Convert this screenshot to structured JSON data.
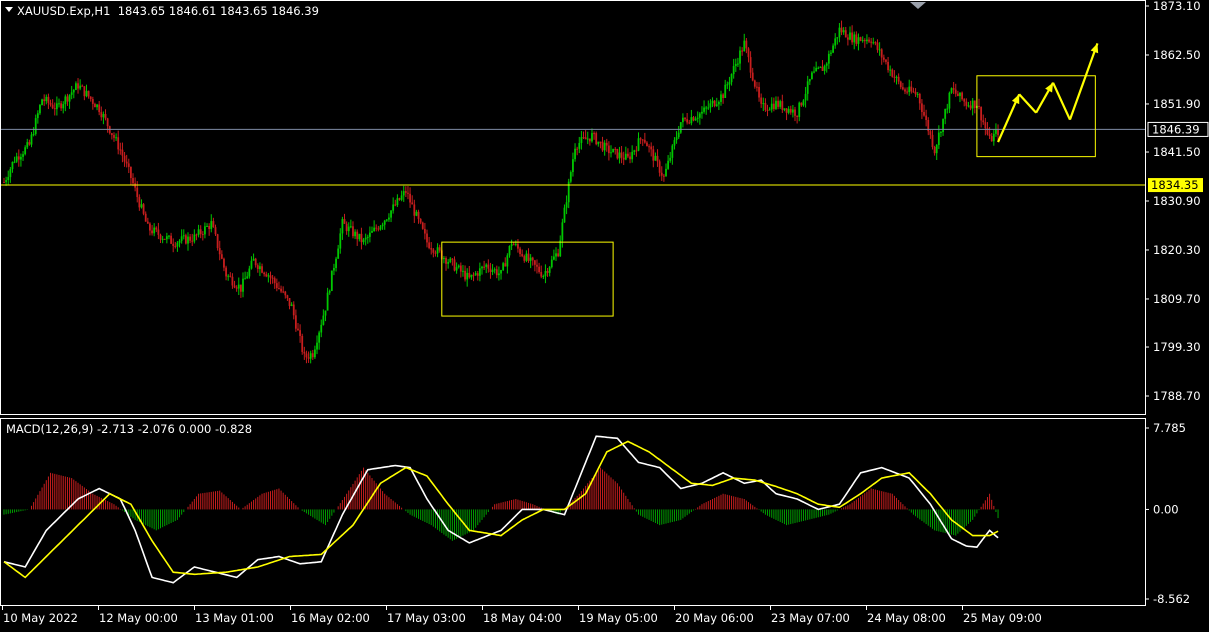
{
  "header": {
    "symbol_line": "XAUUSD.Exp,H1  1843.65 1846.61 1843.65 1846.39",
    "macd_line": "MACD(12,26,9) -2.713 -2.076 0.000 -0.828"
  },
  "colors": {
    "background": "#000000",
    "frame": "#ffffff",
    "text": "#ffffff",
    "bull_candle": "#00c800",
    "bear_candle": "#c81e1e",
    "price_line": "#7f8ca6",
    "level_line": "#ffff00",
    "level_label_bg": "#ffff00",
    "macd_line": "#ffffff",
    "signal_line": "#ffff00",
    "hist_pos": "#c81e1e",
    "hist_neg": "#00a000",
    "annotation": "#ffff00"
  },
  "chart_data": [
    {
      "type": "candlestick",
      "title": "XAUUSD.Exp,H1",
      "ohlc_label": "1843.65 1846.61 1843.65 1846.39",
      "y_ticks": [
        "1873.10",
        "1862.50",
        "1851.90",
        "1841.50",
        "1830.90",
        "1820.30",
        "1809.70",
        "1799.30",
        "1788.70"
      ],
      "ylim": [
        1785.0,
        1874.0
      ],
      "x_ticks": [
        "10 May 2022",
        "12 May 00:00",
        "13 May 01:00",
        "16 May 02:00",
        "17 May 03:00",
        "18 May 04:00",
        "19 May 05:00",
        "20 May 06:00",
        "23 May 07:00",
        "24 May 08:00",
        "25 May 09:00"
      ],
      "current_price": {
        "value": 1846.39,
        "label": "1846.39"
      },
      "horizontal_level": {
        "value": 1834.35,
        "label": "1834.35"
      },
      "close_anchors": [
        [
          0,
          1835
        ],
        [
          5,
          1840
        ],
        [
          12,
          1843
        ],
        [
          18,
          1853
        ],
        [
          25,
          1851
        ],
        [
          35,
          1856
        ],
        [
          45,
          1851
        ],
        [
          55,
          1842
        ],
        [
          60,
          1836
        ],
        [
          68,
          1825
        ],
        [
          80,
          1822
        ],
        [
          90,
          1823
        ],
        [
          98,
          1826
        ],
        [
          105,
          1815
        ],
        [
          112,
          1812
        ],
        [
          118,
          1818
        ],
        [
          125,
          1815
        ],
        [
          130,
          1812
        ],
        [
          136,
          1808
        ],
        [
          142,
          1797
        ],
        [
          146,
          1798
        ],
        [
          152,
          1808
        ],
        [
          160,
          1826
        ],
        [
          170,
          1822
        ],
        [
          180,
          1827
        ],
        [
          190,
          1833
        ],
        [
          200,
          1822
        ],
        [
          210,
          1818
        ],
        [
          220,
          1814
        ],
        [
          228,
          1817
        ],
        [
          235,
          1815
        ],
        [
          240,
          1822
        ],
        [
          248,
          1818
        ],
        [
          255,
          1815
        ],
        [
          262,
          1820
        ],
        [
          270,
          1843
        ],
        [
          278,
          1845
        ],
        [
          285,
          1842
        ],
        [
          295,
          1840
        ],
        [
          302,
          1845
        ],
        [
          312,
          1836
        ],
        [
          320,
          1848
        ],
        [
          330,
          1850
        ],
        [
          340,
          1854
        ],
        [
          350,
          1865
        ],
        [
          358,
          1851
        ],
        [
          365,
          1852
        ],
        [
          375,
          1850
        ],
        [
          382,
          1858
        ],
        [
          388,
          1860
        ],
        [
          395,
          1868
        ],
        [
          402,
          1866
        ],
        [
          410,
          1866
        ],
        [
          418,
          1860
        ],
        [
          425,
          1855
        ],
        [
          432,
          1854
        ],
        [
          440,
          1842
        ],
        [
          448,
          1855
        ],
        [
          455,
          1852
        ],
        [
          460,
          1852
        ],
        [
          466,
          1844
        ],
        [
          470,
          1846
        ]
      ],
      "rectangles": [
        {
          "x_bars": [
            207,
            288
          ],
          "y_values": [
            1822.0,
            1806.0
          ]
        },
        {
          "x_bars": [
            460,
            516
          ],
          "y_values": [
            1858.0,
            1840.5
          ]
        }
      ],
      "projection_path": [
        {
          "bar": 470,
          "value": 1843.65
        },
        {
          "bar": 480,
          "value": 1854.0
        },
        {
          "bar": 488,
          "value": 1850.0
        },
        {
          "bar": 496,
          "value": 1856.5
        },
        {
          "bar": 504,
          "value": 1848.5
        },
        {
          "bar": 517,
          "value": 1865.0
        }
      ]
    },
    {
      "type": "line",
      "title": "MACD(12,26,9)",
      "y_ticks": [
        "7.785",
        "0.00",
        "-8.562"
      ],
      "ylim": [
        -8.562,
        7.785
      ],
      "series": [
        {
          "values_anchors": [
            [
              0,
              -5.0
            ],
            [
              10,
              -5.5
            ],
            [
              20,
              -2.0
            ],
            [
              35,
              1.0
            ],
            [
              45,
              2.0
            ],
            [
              55,
              1.0
            ],
            [
              62,
              -2.0
            ],
            [
              70,
              -6.5
            ],
            [
              80,
              -7.0
            ],
            [
              90,
              -5.5
            ],
            [
              100,
              -6.0
            ],
            [
              110,
              -6.5
            ],
            [
              120,
              -4.8
            ],
            [
              130,
              -4.5
            ],
            [
              140,
              -5.2
            ],
            [
              150,
              -5.0
            ],
            [
              160,
              -0.5
            ],
            [
              172,
              3.8
            ],
            [
              185,
              4.2
            ],
            [
              192,
              4.0
            ],
            [
              200,
              1.0
            ],
            [
              210,
              -2.0
            ],
            [
              220,
              -3.2
            ],
            [
              235,
              -2.0
            ],
            [
              245,
              0.0
            ],
            [
              255,
              0.0
            ],
            [
              265,
              -0.5
            ],
            [
              272,
              3.0
            ],
            [
              280,
              7.0
            ],
            [
              290,
              6.8
            ],
            [
              300,
              4.5
            ],
            [
              310,
              4.0
            ],
            [
              320,
              2.0
            ],
            [
              330,
              2.5
            ],
            [
              340,
              3.5
            ],
            [
              350,
              2.5
            ],
            [
              358,
              2.8
            ],
            [
              365,
              1.5
            ],
            [
              375,
              1.0
            ],
            [
              385,
              0.0
            ],
            [
              395,
              0.5
            ],
            [
              405,
              3.5
            ],
            [
              415,
              4.0
            ],
            [
              428,
              3.0
            ],
            [
              438,
              0.5
            ],
            [
              448,
              -2.8
            ],
            [
              455,
              -3.5
            ],
            [
              460,
              -3.6
            ],
            [
              466,
              -2.0
            ],
            [
              470,
              -2.713
            ]
          ]
        },
        {
          "values_anchors": [
            [
              0,
              -5.0
            ],
            [
              10,
              -6.5
            ],
            [
              20,
              -4.5
            ],
            [
              35,
              -1.5
            ],
            [
              50,
              1.5
            ],
            [
              60,
              0.5
            ],
            [
              70,
              -3.0
            ],
            [
              80,
              -6.0
            ],
            [
              90,
              -6.2
            ],
            [
              105,
              -6.0
            ],
            [
              120,
              -5.5
            ],
            [
              135,
              -4.5
            ],
            [
              150,
              -4.3
            ],
            [
              165,
              -1.5
            ],
            [
              178,
              2.5
            ],
            [
              190,
              4.0
            ],
            [
              200,
              3.2
            ],
            [
              210,
              0.5
            ],
            [
              220,
              -2.0
            ],
            [
              235,
              -2.5
            ],
            [
              245,
              -1.0
            ],
            [
              255,
              0.0
            ],
            [
              265,
              0.0
            ],
            [
              275,
              1.5
            ],
            [
              285,
              5.5
            ],
            [
              295,
              6.5
            ],
            [
              305,
              5.5
            ],
            [
              315,
              4.0
            ],
            [
              325,
              2.5
            ],
            [
              335,
              2.3
            ],
            [
              345,
              3.0
            ],
            [
              355,
              2.8
            ],
            [
              365,
              2.2
            ],
            [
              375,
              1.5
            ],
            [
              385,
              0.5
            ],
            [
              395,
              0.2
            ],
            [
              405,
              1.5
            ],
            [
              415,
              3.0
            ],
            [
              428,
              3.5
            ],
            [
              438,
              1.5
            ],
            [
              448,
              -1.0
            ],
            [
              458,
              -2.5
            ],
            [
              466,
              -2.5
            ],
            [
              470,
              -2.076
            ]
          ]
        }
      ],
      "histogram_anchors": [
        [
          0,
          -0.5
        ],
        [
          12,
          0.0
        ],
        [
          22,
          3.5
        ],
        [
          32,
          3.0
        ],
        [
          42,
          1.5
        ],
        [
          52,
          0.5
        ],
        [
          62,
          -1.0
        ],
        [
          72,
          -2.0
        ],
        [
          82,
          -1.0
        ],
        [
          92,
          1.5
        ],
        [
          102,
          1.8
        ],
        [
          112,
          0.0
        ],
        [
          122,
          1.5
        ],
        [
          130,
          2.0
        ],
        [
          140,
          0.0
        ],
        [
          152,
          -1.5
        ],
        [
          162,
          1.5
        ],
        [
          170,
          4.0
        ],
        [
          180,
          1.5
        ],
        [
          192,
          -0.5
        ],
        [
          202,
          -1.5
        ],
        [
          212,
          -3.0
        ],
        [
          222,
          -2.0
        ],
        [
          232,
          0.5
        ],
        [
          242,
          1.0
        ],
        [
          250,
          0.5
        ],
        [
          262,
          -0.5
        ],
        [
          272,
          1.5
        ],
        [
          282,
          4.0
        ],
        [
          290,
          2.5
        ],
        [
          300,
          -0.5
        ],
        [
          310,
          -1.5
        ],
        [
          320,
          -1.0
        ],
        [
          330,
          0.5
        ],
        [
          340,
          1.5
        ],
        [
          350,
          1.0
        ],
        [
          360,
          -0.5
        ],
        [
          370,
          -1.5
        ],
        [
          380,
          -1.0
        ],
        [
          390,
          -0.5
        ],
        [
          400,
          0.5
        ],
        [
          410,
          2.0
        ],
        [
          420,
          1.5
        ],
        [
          430,
          -0.5
        ],
        [
          440,
          -2.0
        ],
        [
          450,
          -2.5
        ],
        [
          458,
          -1.0
        ],
        [
          466,
          1.5
        ],
        [
          470,
          -0.828
        ]
      ]
    }
  ]
}
